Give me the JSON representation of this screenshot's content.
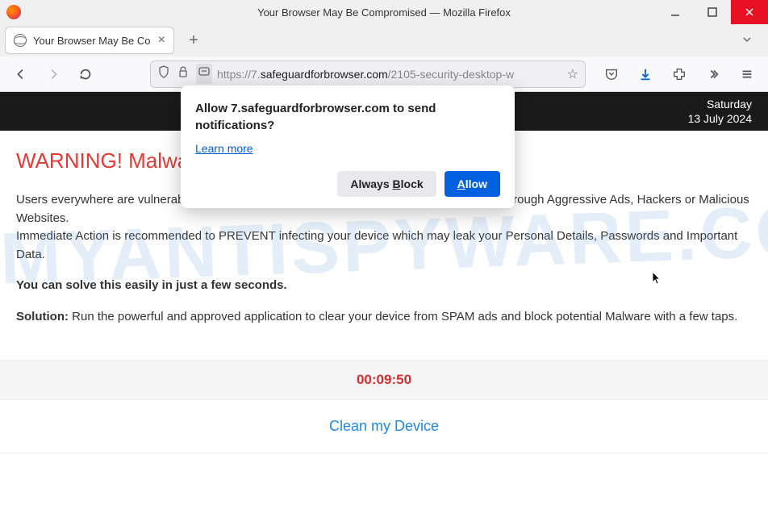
{
  "window": {
    "title": "Your Browser May Be Compromised — Mozilla Firefox"
  },
  "tab": {
    "title": "Your Browser May Be Co"
  },
  "url": {
    "prefix": "https://7.",
    "domain": "safeguardforbrowser.com",
    "path": "/2105-security-desktop-w"
  },
  "banner": {
    "day": "Saturday",
    "date": "13 July 2024"
  },
  "page": {
    "warning_title": "WARNING! Malwares",
    "p1": "Users everywhere are vulnerable and susceptible to Malware attacks. One can be injected through Aggressive Ads, Hackers or Malicious Websites.",
    "p2": "Immediate Action is recommended to PREVENT infecting your device which may leak your Personal Details, Passwords and Important Data.",
    "p3": "You can solve this easily in just a few seconds.",
    "solution_label": "Solution:",
    "solution_text": " Run the powerful and approved application to clear your device from SPAM ads and block potential Malware with a few taps.",
    "timer": "00:09:50",
    "clean_label": "Clean my Device"
  },
  "notif": {
    "title": "Allow 7.safeguardforbrowser.com to send notifications?",
    "learn": "Learn more",
    "block_pre": "Always ",
    "block_ul": "B",
    "block_post": "lock",
    "allow_ul": "A",
    "allow_post": "llow"
  },
  "watermark": "MYANTISPYWARE.COM"
}
